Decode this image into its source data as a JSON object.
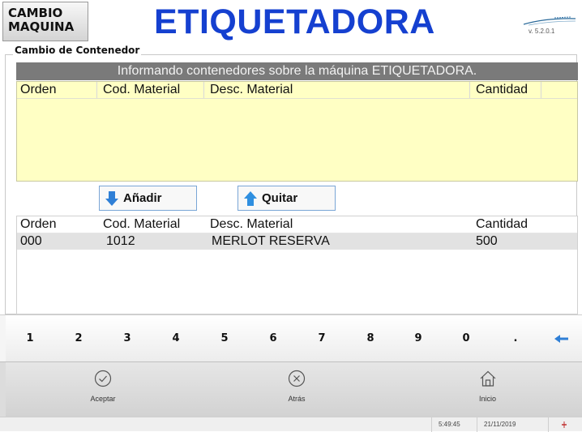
{
  "header": {
    "change_machine": [
      "CAMBIO",
      "MAQUINA"
    ],
    "title": "ETIQUETADORA",
    "version": "v. 5.2.0.1"
  },
  "group": {
    "label": "Cambio de Contenedor"
  },
  "banner": "Informando contenedores sobre la máquina ETIQUETADORA.",
  "columns": [
    "Orden",
    "Cod. Material",
    "Desc. Material",
    "Cantidad"
  ],
  "top_grid": {
    "rows": []
  },
  "actions": {
    "add": "Añadir",
    "remove": "Quitar"
  },
  "bottom_grid": {
    "rows": [
      {
        "orden": "000",
        "cod": "1012",
        "desc": "MERLOT RESERVA",
        "cantidad": "500"
      }
    ]
  },
  "keypad": [
    "1",
    "2",
    "3",
    "4",
    "5",
    "6",
    "7",
    "8",
    "9",
    "0",
    ".",
    "backspace-icon"
  ],
  "nav": [
    {
      "label": "Aceptar",
      "icon": "check-circle-icon"
    },
    {
      "label": "Atrás",
      "icon": "close-circle-icon"
    },
    {
      "label": "Inicio",
      "icon": "home-icon"
    }
  ],
  "status": {
    "time": "5:49:45",
    "date": "21/11/2019"
  },
  "colors": {
    "title": "#1540d0",
    "grid_yellow": "#ffffc4",
    "banner": "#7a7a7a",
    "selected_row": "#e2e2e2"
  }
}
